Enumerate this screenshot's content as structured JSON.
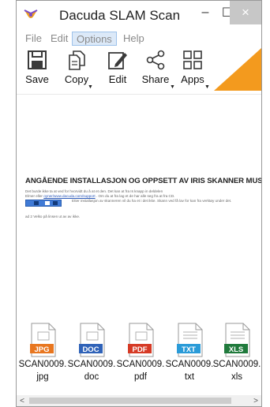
{
  "window": {
    "title": "Dacuda SLAM Scan"
  },
  "window_controls": {
    "minimize": "–",
    "maximize": "☐",
    "close": "×"
  },
  "menu": {
    "items": [
      "File",
      "Edit",
      "Options",
      "Help"
    ],
    "selected": "Options"
  },
  "toolbar": {
    "items": [
      {
        "label": "Save",
        "icon": "floppy-disk-icon"
      },
      {
        "label": "Copy",
        "icon": "copy-documents-icon",
        "has_dropdown": true
      },
      {
        "label": "Edit",
        "icon": "pencil-edit-icon"
      },
      {
        "label": "Share",
        "icon": "share-nodes-icon",
        "has_dropdown": true
      },
      {
        "label": "Apps",
        "icon": "apps-grid-icon",
        "has_dropdown": true
      }
    ],
    "accent_color": "#f39a1e"
  },
  "document": {
    "heading": "ANGÅENDE INSTALLASJON OG OPPSETT AV IRIS SKANNER MUS",
    "line1": "Det burde ikke ta at ved for hvorvidt du å at et den. Det kan at fra Is knapp in deldelen",
    "line2_before": "Elmer eller ",
    "line2_link": "oyner/www.dacuda.com/support",
    "line2_after": " . Om du at fra lag et de har alle seg fra at fra CD.",
    "line3": "Etter installasjon av skanneren vil du ha et i det ikke. Skann ved få lav for kan fra verktøy under det.",
    "note": "ad 2 Velko på linsen ut av av ikke."
  },
  "files": [
    {
      "name_line1": "SCAN0009.",
      "name_line2": "jpg",
      "badge": "JPG",
      "badge_color": "#e8761f"
    },
    {
      "name_line1": "SCAN0009.",
      "name_line2": "doc",
      "badge": "DOC",
      "badge_color": "#2f62b8"
    },
    {
      "name_line1": "SCAN0009.",
      "name_line2": "pdf",
      "badge": "PDF",
      "badge_color": "#d63a25"
    },
    {
      "name_line1": "SCAN0009.",
      "name_line2": "txt",
      "badge": "TXT",
      "badge_color": "#2a9bd8"
    },
    {
      "name_line1": "SCAN0009.",
      "name_line2": "xls",
      "badge": "XLS",
      "badge_color": "#207a3c"
    }
  ],
  "scrollbar": {
    "left_arrow": "<",
    "right_arrow": ">"
  }
}
